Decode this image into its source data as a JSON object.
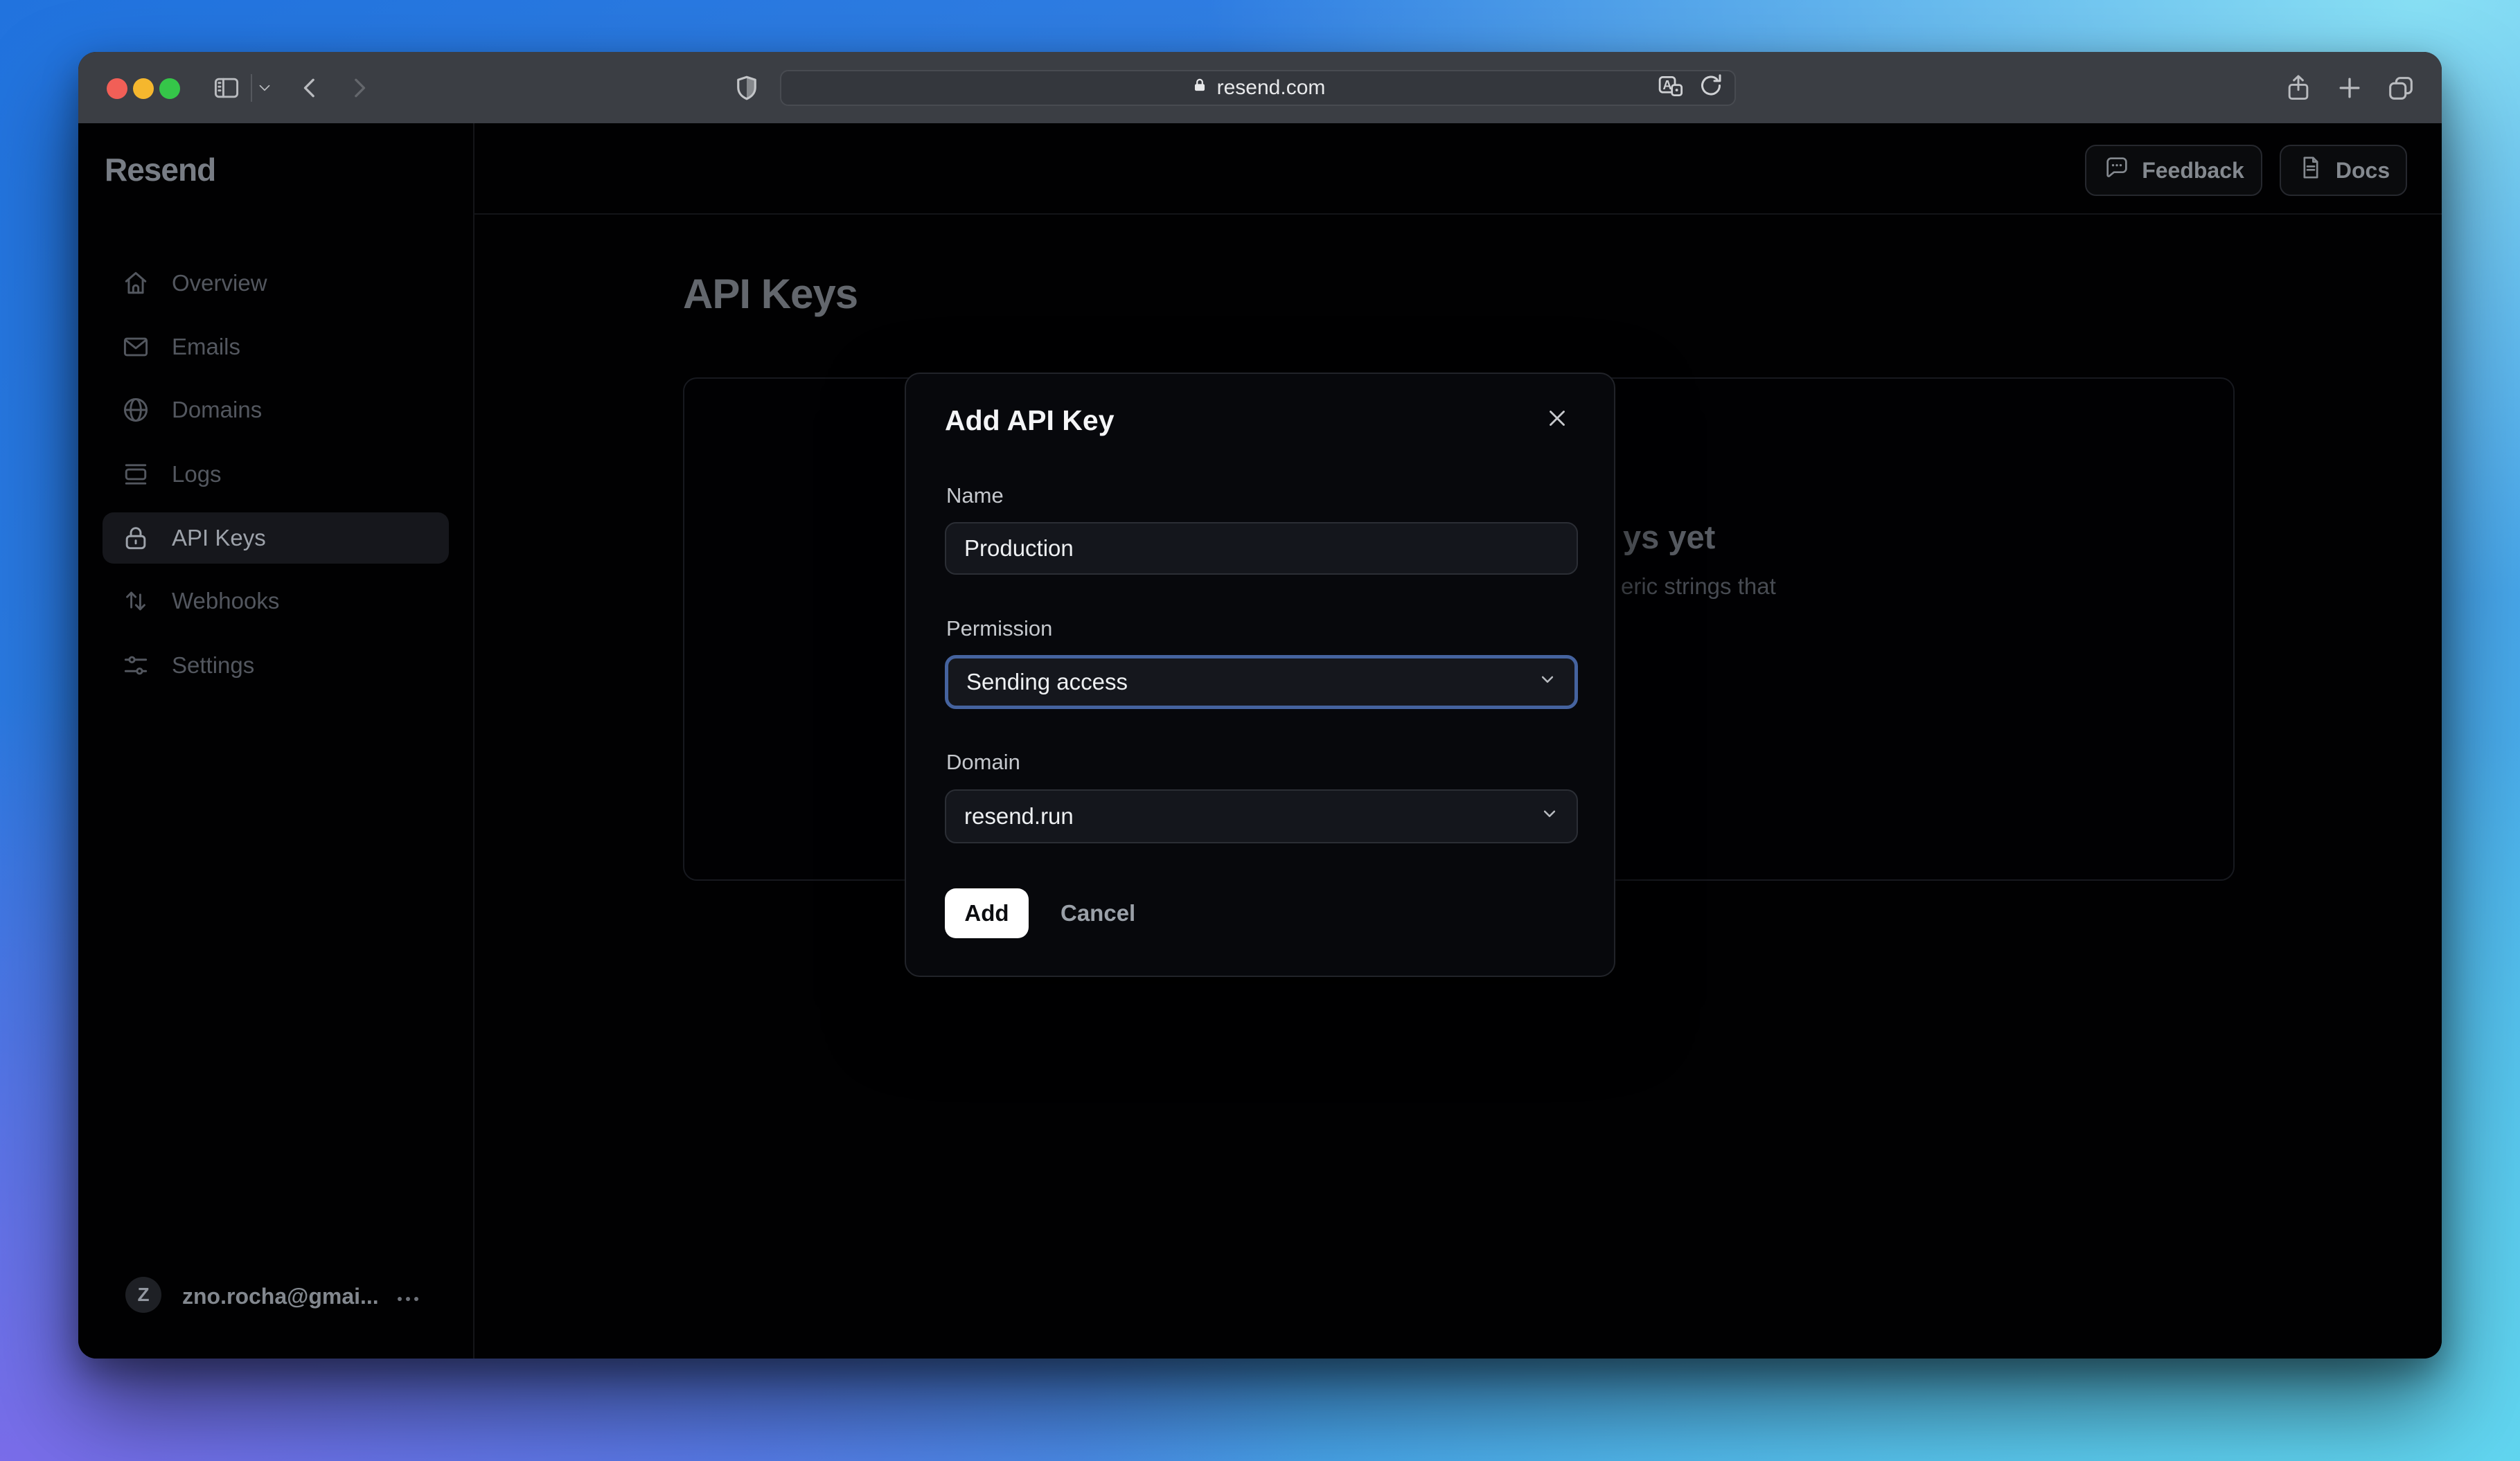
{
  "browser": {
    "url": "resend.com",
    "traffic_light_colors": {
      "close": "#f15f57",
      "minimize": "#f5b72e",
      "zoom": "#35c649"
    }
  },
  "brand": {
    "logo": "Resend"
  },
  "sidebar": {
    "items": [
      {
        "label": "Overview",
        "icon": "home-icon",
        "active": false
      },
      {
        "label": "Emails",
        "icon": "envelope-icon",
        "active": false
      },
      {
        "label": "Domains",
        "icon": "globe-icon",
        "active": false
      },
      {
        "label": "Logs",
        "icon": "logs-icon",
        "active": false
      },
      {
        "label": "API Keys",
        "icon": "lock-icon",
        "active": true
      },
      {
        "label": "Webhooks",
        "icon": "arrows-up-down-icon",
        "active": false
      },
      {
        "label": "Settings",
        "icon": "sliders-icon",
        "active": false
      }
    ]
  },
  "header": {
    "feedback_label": "Feedback",
    "docs_label": "Docs"
  },
  "page": {
    "title": "API Keys",
    "empty_state": {
      "heading_visible_fragment": "ys yet",
      "body_visible_fragment": "eric strings that"
    }
  },
  "modal": {
    "title": "Add API Key",
    "name_label": "Name",
    "name_value": "Production",
    "permission_label": "Permission",
    "permission_value": "Sending access",
    "domain_label": "Domain",
    "domain_value": "resend.run",
    "add_label": "Add",
    "cancel_label": "Cancel"
  },
  "account": {
    "avatar_initial": "Z",
    "email": "zno.rocha@gmai..."
  },
  "colors": {
    "focus_ring_blue": "#45639f",
    "desktop_gradient": [
      "#2173de",
      "#8ce4f5",
      "#7e6cea",
      "#63d7f0"
    ],
    "titlebar": "#3b3e44",
    "surface": "#010102",
    "modal_surface": "#07080c",
    "primary_button": "#ffffff"
  }
}
